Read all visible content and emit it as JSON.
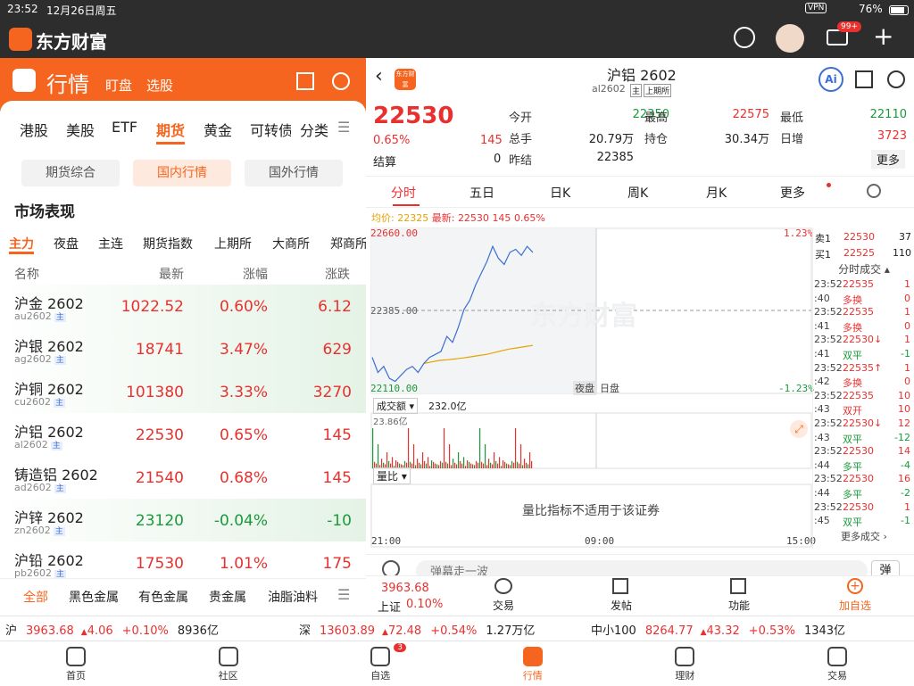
{
  "status": {
    "time": "23:52",
    "date": "12月26日周五",
    "vpn": "VPN",
    "battery": "76%"
  },
  "app": {
    "name": "东方财富",
    "mail_badge": "99+"
  },
  "left": {
    "title": "行情",
    "sub1": "盯盘",
    "sub2": "选股",
    "tabs": [
      "港股",
      "美股",
      "ETF",
      "期货",
      "黄金",
      "可转债",
      "分类"
    ],
    "segments": [
      "期货综合",
      "国内行情",
      "国外行情"
    ],
    "section": "市场表现",
    "subtabs": [
      "主力",
      "夜盘",
      "主连",
      "期货指数",
      "上期所",
      "大商所",
      "郑商所"
    ],
    "cols": {
      "name": "名称",
      "price": "最新",
      "pct": "涨幅",
      "chg": "涨跌"
    },
    "rows": [
      {
        "name": "沪金 2602",
        "code": "au2602",
        "tag": "主",
        "price": "1022.52",
        "pct": "0.60%",
        "chg": "6.12",
        "up": true,
        "hl": true
      },
      {
        "name": "沪银 2602",
        "code": "ag2602",
        "tag": "主",
        "price": "18741",
        "pct": "3.47%",
        "chg": "629",
        "up": true,
        "hl": true
      },
      {
        "name": "沪铜 2602",
        "code": "cu2602",
        "tag": "主",
        "price": "101380",
        "pct": "3.33%",
        "chg": "3270",
        "up": true,
        "hl": true
      },
      {
        "name": "沪铝 2602",
        "code": "al2602",
        "tag": "主",
        "price": "22530",
        "pct": "0.65%",
        "chg": "145",
        "up": true,
        "hl": false
      },
      {
        "name": "铸造铝 2602",
        "code": "ad2602",
        "tag": "主",
        "price": "21540",
        "pct": "0.68%",
        "chg": "145",
        "up": true,
        "hl": false
      },
      {
        "name": "沪锌 2602",
        "code": "zn2602",
        "tag": "主",
        "price": "23120",
        "pct": "-0.04%",
        "chg": "-10",
        "up": false,
        "hl": true
      },
      {
        "name": "沪铅 2602",
        "code": "pb2602",
        "tag": "主",
        "price": "17530",
        "pct": "1.01%",
        "chg": "175",
        "up": true,
        "hl": false
      }
    ],
    "cats": [
      "全部",
      "黑色金属",
      "有色金属",
      "贵金属",
      "油脂油料"
    ]
  },
  "right": {
    "title": "沪铝 2602",
    "code": "al2602",
    "tag1": "主",
    "tag2": "上期所",
    "logo": "东方财富",
    "price": "22530",
    "pct": "0.65%",
    "chg": "145",
    "settle_label": "结算",
    "settle": "0",
    "stats": [
      [
        "今开",
        "22350"
      ],
      [
        "最高",
        "22575"
      ],
      [
        "最低",
        "22110"
      ],
      [
        "总手",
        "20.79万"
      ],
      [
        "持仓",
        "30.34万"
      ],
      [
        "日增",
        "3723"
      ],
      [
        "昨结",
        "22385"
      ]
    ],
    "more": "更多",
    "tabs": [
      "分时",
      "五日",
      "日K",
      "周K",
      "月K",
      "更多"
    ],
    "legend": {
      "avg_label": "均价:",
      "avg": "22325",
      "last_label": "最新:",
      "last": "22530",
      "chg": "145",
      "pct": "0.65%"
    },
    "axis": {
      "top": "22660.00",
      "mid": "22385.00",
      "bot": "22110.00",
      "top_pct": "1.23%",
      "bot_pct": "-1.23%",
      "night": "夜盘",
      "day": "日盘",
      "t0": "21:00",
      "t1": "09:00",
      "t2": "15:00",
      "watermark": "东方财富"
    },
    "vol": {
      "label": "成交额",
      "value": "232.0亿",
      "max": "23.86亿"
    },
    "ratio": {
      "label": "量比",
      "msg": "量比指标不适用于该证券"
    },
    "book": [
      {
        "side": "卖1",
        "price": "22530",
        "vol": "37"
      },
      {
        "side": "买1",
        "price": "22525",
        "vol": "110"
      }
    ],
    "trades_title": "分时成交",
    "trades": [
      {
        "t": "23:52",
        "v1": "22535",
        "n": "1",
        "c": "red"
      },
      {
        "t": ":40",
        "v1": "多换",
        "n": "0",
        "c": "red"
      },
      {
        "t": "23:52",
        "v1": "22535",
        "n": "1",
        "c": "red"
      },
      {
        "t": ":41",
        "v1": "多换",
        "n": "0",
        "c": "red"
      },
      {
        "t": "23:52",
        "v1": "22530↓",
        "n": "1",
        "c": "red"
      },
      {
        "t": ":41",
        "v1": "双平",
        "n": "-1",
        "c": "green"
      },
      {
        "t": "23:52",
        "v1": "22535↑",
        "n": "1",
        "c": "red"
      },
      {
        "t": ":42",
        "v1": "多换",
        "n": "0",
        "c": "red"
      },
      {
        "t": "23:52",
        "v1": "22535",
        "n": "10",
        "c": "red"
      },
      {
        "t": ":43",
        "v1": "双开",
        "n": "10",
        "c": "red"
      },
      {
        "t": "23:52",
        "v1": "22530↓",
        "n": "12",
        "c": "red"
      },
      {
        "t": ":43",
        "v1": "双平",
        "n": "-12",
        "c": "green"
      },
      {
        "t": "23:52",
        "v1": "22530",
        "n": "14",
        "c": "red"
      },
      {
        "t": ":44",
        "v1": "多平",
        "n": "-4",
        "c": "green"
      },
      {
        "t": "23:52",
        "v1": "22530",
        "n": "16",
        "c": "red"
      },
      {
        "t": ":44",
        "v1": "多平",
        "n": "-2",
        "c": "green"
      },
      {
        "t": "23:52",
        "v1": "22530",
        "n": "1",
        "c": "red"
      },
      {
        "t": ":45",
        "v1": "双平",
        "n": "-1",
        "c": "green"
      }
    ],
    "trades_more": "更多成交",
    "comment_placeholder": "弹幕走一波",
    "danmu": "弹",
    "bottom": {
      "idx": "3963.68",
      "idx_name": "上证",
      "idx_pct": "0.10%",
      "actions": [
        "交易",
        "发帖",
        "功能",
        "加自选"
      ]
    }
  },
  "indices": [
    {
      "name": "沪",
      "val": "3963.68",
      "chg": "4.06",
      "pct": "+0.10%",
      "amt": "8936亿"
    },
    {
      "name": "深",
      "val": "13603.89",
      "chg": "72.48",
      "pct": "+0.54%",
      "amt": "1.27万亿"
    },
    {
      "name": "中小100",
      "val": "8264.77",
      "chg": "43.32",
      "pct": "+0.53%",
      "amt": "1343亿"
    }
  ],
  "tabbar": [
    {
      "label": "首页"
    },
    {
      "label": "社区"
    },
    {
      "label": "自选",
      "badge": "3"
    },
    {
      "label": "行情"
    },
    {
      "label": "理财"
    },
    {
      "label": "交易"
    }
  ],
  "chart_data": {
    "type": "line",
    "series": [
      {
        "values": [
          22230,
          22180,
          22200,
          22160,
          22150,
          22170,
          22190,
          22200,
          22180,
          22210,
          22230,
          22240,
          22250,
          22300,
          22280,
          22330,
          22390,
          22420,
          22470,
          22510,
          22550,
          22600,
          22560,
          22540,
          22580,
          22590,
          22570,
          22600,
          22580
        ]
      },
      {
        "values": [
          22210,
          22215,
          22220,
          22222,
          22225,
          22228,
          22232,
          22236,
          22240,
          22246,
          22252,
          22258,
          22262,
          22266,
          22270
        ]
      }
    ],
    "ylim": [
      22110,
      22660
    ]
  }
}
